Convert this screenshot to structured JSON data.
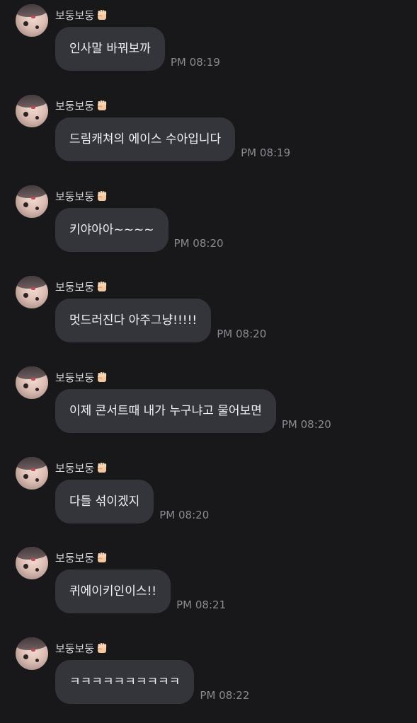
{
  "messages": [
    {
      "sender": "보둥보둥",
      "text": "인사말 바꿔보까",
      "time": "PM 08:19"
    },
    {
      "sender": "보둥보둥",
      "text": "드림캐쳐의 에이스 수아입니다",
      "time": "PM 08:19"
    },
    {
      "sender": "보둥보둥",
      "text": "키야아아~~~~",
      "time": "PM 08:20"
    },
    {
      "sender": "보둥보둥",
      "text": "멋드러진다 아주그냥!!!!!",
      "time": "PM 08:20"
    },
    {
      "sender": "보둥보둥",
      "text": "이제 콘서트때 내가 누구냐고 물어보면",
      "time": "PM 08:20"
    },
    {
      "sender": "보둥보둥",
      "text": "다들 섞이겠지",
      "time": "PM 08:20"
    },
    {
      "sender": "보둥보둥",
      "text": "퀴에이키인이스!!",
      "time": "PM 08:21"
    },
    {
      "sender": "보둥보둥",
      "text": "ㅋㅋㅋㅋㅋㅋㅋㅋㅋㅋ",
      "time": "PM 08:22"
    }
  ],
  "icons": {
    "sender_badge": "raised-fist-icon",
    "avatar": "profile-avatar"
  },
  "colors": {
    "background": "#18181b",
    "bubble": "#34353b",
    "text": "#f1f1f3",
    "sender": "#d6d6d9",
    "timestamp": "#8a8a90"
  }
}
